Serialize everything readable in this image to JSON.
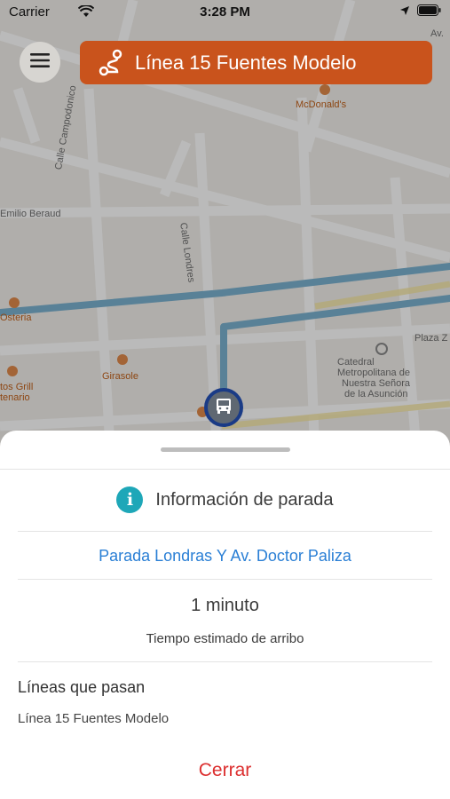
{
  "status_bar": {
    "carrier": "Carrier",
    "time": "3:28 PM"
  },
  "header": {
    "route_title": "Línea 15 Fuentes Modelo"
  },
  "map": {
    "labels": {
      "mcdonalds": "McDonald's",
      "calle_campodonico": "Calle Campodonico",
      "emilio_beraud": "Emilio Beraud",
      "calle_londres": "Calle Londres",
      "osteria": "Osteria",
      "girasole": "Girasole",
      "tos_grill": "tos Grill",
      "tenario": "tenario",
      "plaza": "Plaza Z",
      "catedral_1": "Catedral",
      "catedral_2": "Metropolitana de",
      "catedral_3": "Nuestra Señora",
      "catedral_4": "de la Asunción",
      "av": "Av."
    },
    "route_color": "#7ab1cf"
  },
  "sheet": {
    "info_title": "Información de parada",
    "stop_name": "Parada Londras Y Av. Doctor Paliza",
    "eta_value": "1 minuto",
    "eta_label": "Tiempo estimado de arribo",
    "lines_heading": "Líneas que pasan",
    "lines": [
      "Línea 15 Fuentes Modelo"
    ],
    "close_label": "Cerrar"
  },
  "colors": {
    "banner": "#c9531c",
    "info_icon": "#1ea7b8",
    "stop_name": "#2a7fd5",
    "close": "#dc2f2f",
    "marker_ring": "#1a3b86"
  }
}
